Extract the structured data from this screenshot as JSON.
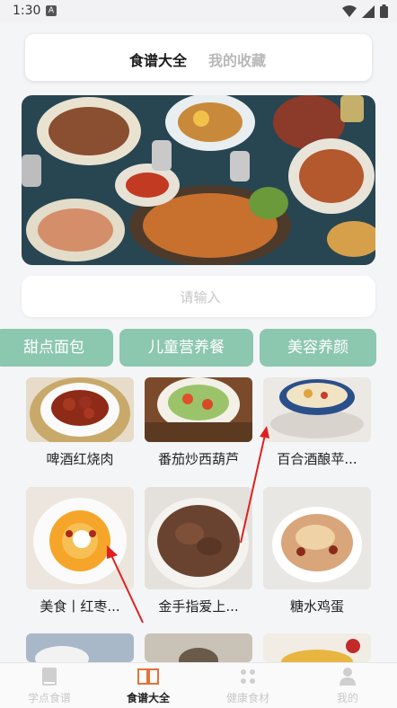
{
  "status_bar": {
    "time": "1:30",
    "notification_icon": "A"
  },
  "top_tabs": {
    "active": "食谱大全",
    "inactive": "我的收藏"
  },
  "search": {
    "placeholder": "请输入"
  },
  "categories": [
    "甜点面包",
    "儿童营养餐",
    "美容养颜"
  ],
  "recipes": [
    {
      "title": "啤酒红烧肉"
    },
    {
      "title": "番茄炒西葫芦"
    },
    {
      "title": "百合酒酿苹..."
    },
    {
      "title": "美食丨红枣..."
    },
    {
      "title": "金手指爱上..."
    },
    {
      "title": "糖水鸡蛋"
    }
  ],
  "bottom_nav": [
    {
      "label": "学点食谱",
      "icon": "book-closed-icon"
    },
    {
      "label": "食谱大全",
      "icon": "book-open-icon"
    },
    {
      "label": "健康食材",
      "icon": "grid-icon"
    },
    {
      "label": "我的",
      "icon": "user-icon"
    }
  ],
  "colors": {
    "accent": "#8cc7b0",
    "nav_active": "#e2733a",
    "background": "#f4f5f7"
  }
}
